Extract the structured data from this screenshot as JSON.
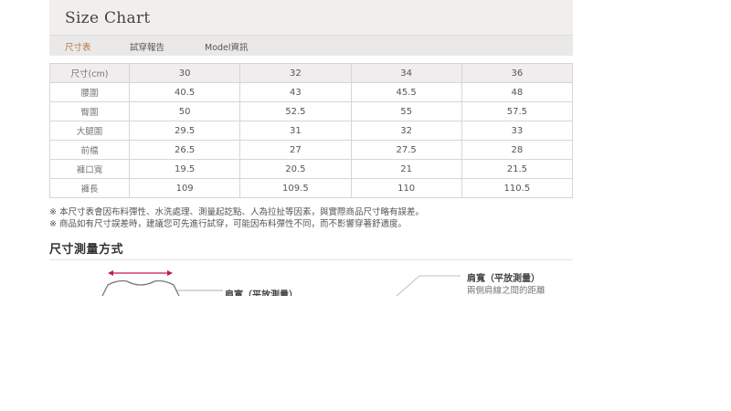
{
  "header": {
    "title": "Size Chart"
  },
  "tabs": [
    {
      "label": "尺寸表"
    },
    {
      "label": "試穿報告"
    },
    {
      "label": "Model資訊"
    }
  ],
  "table": {
    "header": [
      "尺寸(cm)",
      "30",
      "32",
      "34",
      "36"
    ],
    "rows": [
      [
        "腰圍",
        "40.5",
        "43",
        "45.5",
        "48"
      ],
      [
        "臀圍",
        "50",
        "52.5",
        "55",
        "57.5"
      ],
      [
        "大腿圍",
        "29.5",
        "31",
        "32",
        "33"
      ],
      [
        "前檔",
        "26.5",
        "27",
        "27.5",
        "28"
      ],
      [
        "褲口寬",
        "19.5",
        "20.5",
        "21",
        "21.5"
      ],
      [
        "褲長",
        "109",
        "109.5",
        "110",
        "110.5"
      ]
    ]
  },
  "notes": [
    "※ 本尺寸表會因布料彈性、水洗處理、測量起訖點、人為拉扯等因素，與實際商品尺寸略有誤差。",
    "※ 商品如有尺寸誤差時，建議您可先進行試穿，可能因布料彈性不同，而不影響穿著舒適度。"
  ],
  "measure": {
    "section_title": "尺寸測量方式",
    "left_label": "肩寬（平放測量）",
    "right_label": "肩寬（平放測量）",
    "right_sub": "兩側肩線之間的距離"
  },
  "colors": {
    "accent": "#b07a4a",
    "arrow": "#c2185b",
    "header_bg": "#f1efed"
  }
}
